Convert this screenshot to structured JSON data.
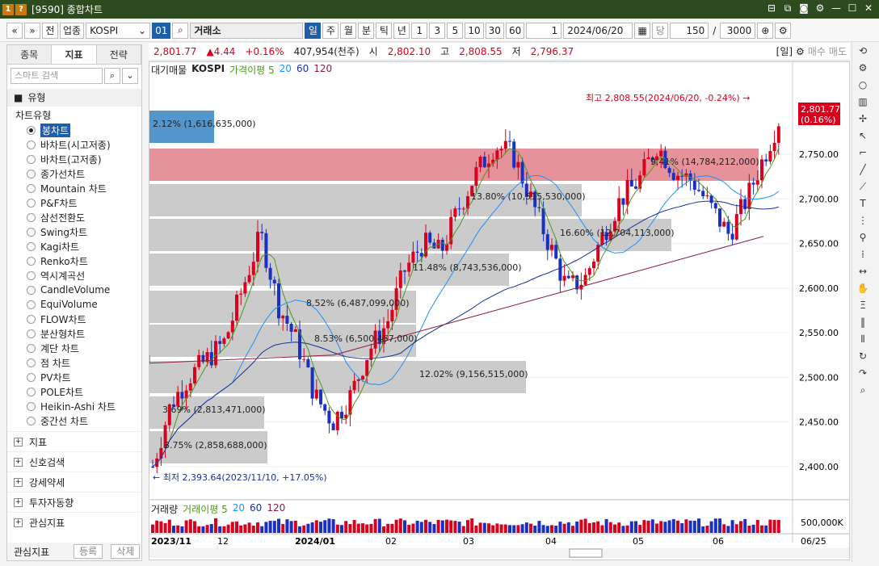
{
  "window": {
    "badge1": "1",
    "badge2": "?",
    "title": "[9590] 종합차트",
    "controls": [
      "⊟",
      "⧉",
      "◙",
      "⚙",
      "—",
      "☐",
      "✕"
    ]
  },
  "toolbar": {
    "nav_prev": "«",
    "nav_down": "»",
    "btn_prev": "전",
    "btn_sector": "업종",
    "market": "KOSPI",
    "code": "01",
    "exchange": "거래소",
    "periods": [
      "일",
      "주",
      "월",
      "분",
      "틱",
      "년"
    ],
    "nums": [
      "1",
      "3",
      "5",
      "10",
      "30",
      "60"
    ],
    "unit": "1",
    "date": "2024/06/20",
    "label_dang": "당",
    "count": "150",
    "slash": "/",
    "total": "3000"
  },
  "quote": {
    "price": "2,801.77",
    "change": "▲4.44",
    "pct": "+0.16%",
    "volume": "407,954(천주)",
    "open_l": "시",
    "open": "2,802.10",
    "high_l": "고",
    "high": "2,808.55",
    "low_l": "저",
    "low": "2,796.37",
    "period_tag": "[일]",
    "buy": "매수",
    "sell": "매도"
  },
  "sidebar": {
    "tabs": [
      "종목",
      "지표",
      "전략"
    ],
    "search_placeholder": "스마트 검색",
    "section": "유형",
    "tree_root": "차트유형",
    "items": [
      "봉차트",
      "바차트(시고저종)",
      "바차트(고저종)",
      "종가선차트",
      "Mountain 차트",
      "P&F차트",
      "삼선전환도",
      "Swing차트",
      "Kagi차트",
      "Renko차트",
      "역시계곡선",
      "CandleVolume",
      "EquiVolume",
      "FLOW차트",
      "분산형차트",
      "계단 차트",
      "점 차트",
      "PV차트",
      "POLE차트",
      "Heikin-Ashi 차트",
      "중간선 차트"
    ],
    "groups": [
      "지표",
      "신호검색",
      "강세약세",
      "투자자동향",
      "관심지표"
    ],
    "footer": "관심지표",
    "register": "등록",
    "delete": "삭제"
  },
  "price_legend": {
    "a": "대기매물",
    "b": "KOSPI",
    "c": "가격이평 5",
    "d": "20",
    "e": "60",
    "f": "120"
  },
  "vol_legend": {
    "a": "거래량",
    "b": "거래이평 5",
    "c": "20",
    "d": "60",
    "e": "120"
  },
  "price_axis": [
    "2,750.00",
    "2,700.00",
    "2,650.00",
    "2,600.00",
    "2,550.00",
    "2,500.00",
    "2,450.00",
    "2,400.00"
  ],
  "vol_axis": "500,000K",
  "x_axis": [
    "2023/11",
    "12",
    "2024/01",
    "02",
    "03",
    "04",
    "05",
    "06",
    "06/25"
  ],
  "price_tag": [
    "2,801.77",
    "(0.16%)"
  ],
  "annotations": {
    "high": "최고 2,808.55(2024/06/20, -0.24%)",
    "low": "최저 2,393.64(2023/11/10, +17.05%)"
  },
  "profile": [
    "2.12% (1,616,635,000)",
    "9.41% (14,784,212,000)",
    "13.80% (10,515,530,000)",
    "16.60% (12,704,113,000)",
    "11.48% (8,743,536,000)",
    "8.52% (6,487,099,000)",
    "8.53% (6,500,457,000)",
    "12.02% (9,156,515,000)",
    "3.69% (2,813,471,000)",
    "3.75% (2,858,688,000)"
  ],
  "colors": {
    "up": "#d8001c",
    "down": "#1a2fc4",
    "ma5": "#4a9a1a",
    "ma20": "#1e90ff",
    "ma60": "#1a2f9a",
    "ma120": "#8b2040",
    "band": "#c8c8c8",
    "band_hi": "#e58c96",
    "band_top": "#4a90c8"
  }
}
